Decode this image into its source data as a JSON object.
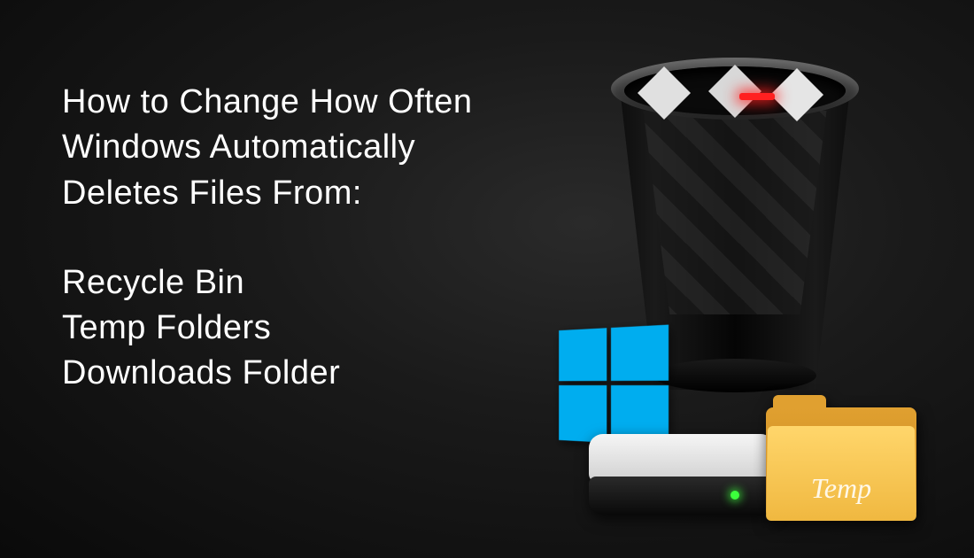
{
  "heading": {
    "line1": "How to Change How Often",
    "line2": "Windows Automatically",
    "line3": "Deletes Files From:"
  },
  "list": {
    "item1": "Recycle Bin",
    "item2": "Temp Folders",
    "item3": "Downloads Folder"
  },
  "folder": {
    "label": "Temp"
  },
  "colors": {
    "text": "#ffffff",
    "windows_blue": "#00adef",
    "folder_yellow": "#f0b840",
    "led_green": "#3cff3c",
    "led_red": "#ff2020"
  }
}
